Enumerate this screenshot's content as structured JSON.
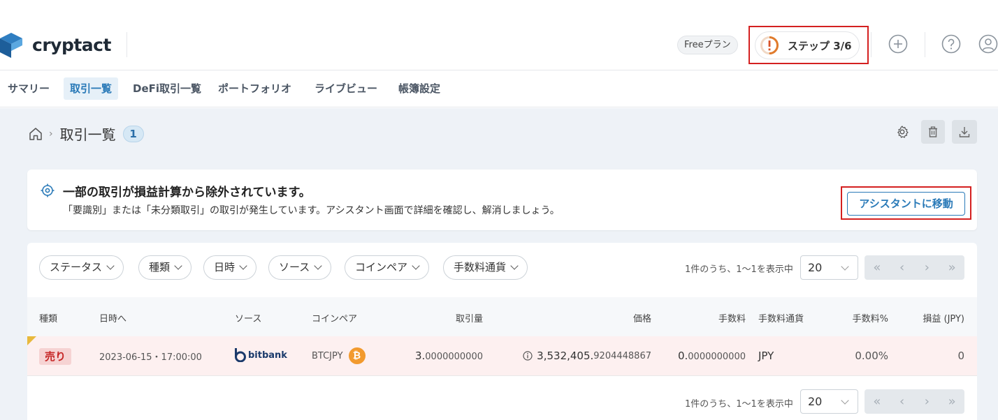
{
  "brand": {
    "name": "cryptact"
  },
  "header": {
    "plan_badge": "Freeプラン",
    "step_label": "ステップ 3/6",
    "step_progress": 0.5
  },
  "nav": {
    "items": [
      {
        "label": "サマリー"
      },
      {
        "label": "取引一覧"
      },
      {
        "label": "DeFi取引一覧"
      },
      {
        "label": "ポートフォリオ"
      },
      {
        "label": "ライブビュー"
      },
      {
        "label": "帳簿設定"
      }
    ],
    "active_index": 1
  },
  "page": {
    "title": "取引一覧",
    "count": "1",
    "separator": "›"
  },
  "alert": {
    "title": "一部の取引が損益計算から除外されています。",
    "description": "「要識別」または「未分類取引」の取引が発生しています。アシスタント画面で詳細を確認し、解消しましょう。",
    "button": "アシスタントに移動"
  },
  "filters": [
    "ステータス",
    "種類",
    "日時",
    "ソース",
    "コインペア",
    "手数料通貨"
  ],
  "pagination": {
    "summary": "1件のうち、1〜1を表示中",
    "page_size": "20",
    "buttons": [
      "«",
      "‹",
      "›",
      "»"
    ]
  },
  "table": {
    "columns": [
      "種類",
      "日時へ",
      "ソース",
      "コインペア",
      "取引量",
      "価格",
      "手数料",
      "手数料通貨",
      "手数料%",
      "損益 (JPY)"
    ],
    "rows": [
      {
        "type": "売り",
        "datetime": "2023-06-15・17:00:00",
        "source": "bitbank",
        "pair": "BTCJPY",
        "coin_icon": "₿",
        "amount_int": "3.",
        "amount_dec": "0000000000",
        "price_int": "3,532,405.",
        "price_dec": "9204448867",
        "fee_int": "0.",
        "fee_dec": "0000000000",
        "fee_currency": "JPY",
        "fee_pct": "0.00%",
        "pnl": "0"
      }
    ]
  },
  "colors": {
    "accent": "#2a7ab8",
    "highlight_box": "#d42020",
    "sell": "#c62626",
    "btc": "#f29a2e"
  },
  "icons": [
    "logo-icon",
    "warning-ring-icon",
    "plus-circle-icon",
    "help-icon",
    "user-icon",
    "home-icon",
    "gear-icon",
    "trash-icon",
    "download-icon",
    "target-icon",
    "info-icon",
    "bitbank-logo-icon",
    "bitcoin-icon"
  ]
}
